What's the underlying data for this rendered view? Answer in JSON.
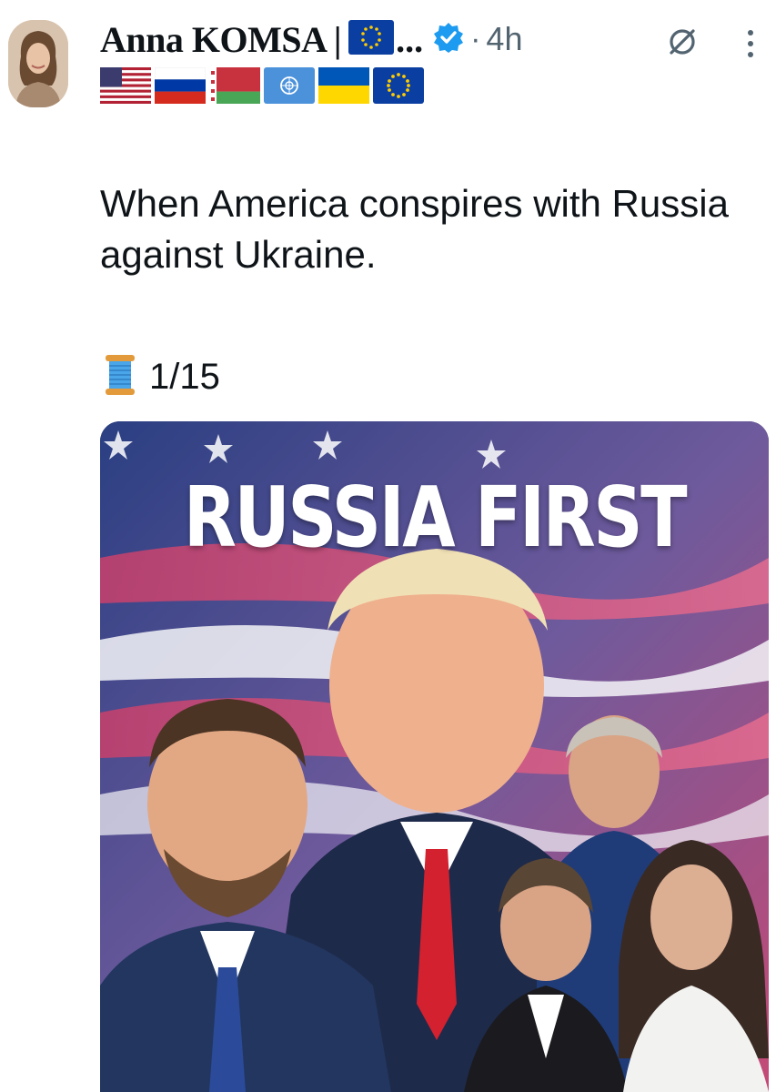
{
  "post": {
    "author": {
      "display_name": "Anna KOMSA |",
      "ellipsis": "...",
      "verified": true,
      "flags": [
        "us-flag",
        "russia-flag",
        "belarus-flag",
        "un-flag",
        "ukraine-flag",
        "eu-flag"
      ]
    },
    "dot": "·",
    "timestamp": "4h",
    "text": "When America conspires with Russia against Ukraine.",
    "thread": {
      "icon": "spool-of-thread-icon",
      "count": "1/15"
    },
    "media": {
      "headline": "RUSSIA FIRST"
    }
  },
  "colors": {
    "verified_blue": "#1d9bf0",
    "secondary_text": "#536471",
    "primary_text": "#0f1419"
  }
}
